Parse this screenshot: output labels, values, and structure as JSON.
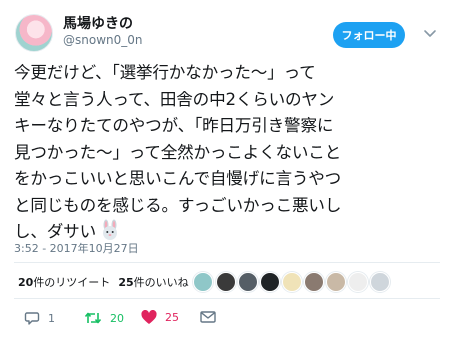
{
  "user": {
    "display_name": "馬場ゆきの",
    "handle": "@snown0_0n",
    "follow_label": "フォロー中"
  },
  "tweet": {
    "lines": [
      "今更だけど、「選挙行かなかった〜」って",
      "堂々と言う人って、田舎の中2くらいのヤン",
      "キーなりたてのやつが、「昨日万引き警察に",
      "見つかった〜」って全然かっこよくないこと",
      "をかっこいいと思いこんで自慢げに言うやつ",
      "と同じものを感じる。すっごいかっこ悪いし",
      "し、ダサい"
    ],
    "timestamp": "3:52 - 2017年10月27日"
  },
  "stats": {
    "retweets_count": "20",
    "retweets_label": "件のリツイート",
    "likes_count": "25",
    "likes_label": "件のいいね"
  },
  "actions": {
    "reply_count": "1",
    "retweet_count": "20",
    "like_count": "25"
  },
  "colors": {
    "accent": "#1da1f2",
    "retweet": "#17bf63",
    "like": "#e0245e",
    "muted": "#657786"
  },
  "icons": {
    "follow_dropdown": "chevron-down-icon",
    "emoji": "rabbit-face-icon",
    "reply": "reply-icon",
    "retweet": "retweet-icon",
    "like": "heart-icon",
    "dm": "envelope-icon"
  }
}
